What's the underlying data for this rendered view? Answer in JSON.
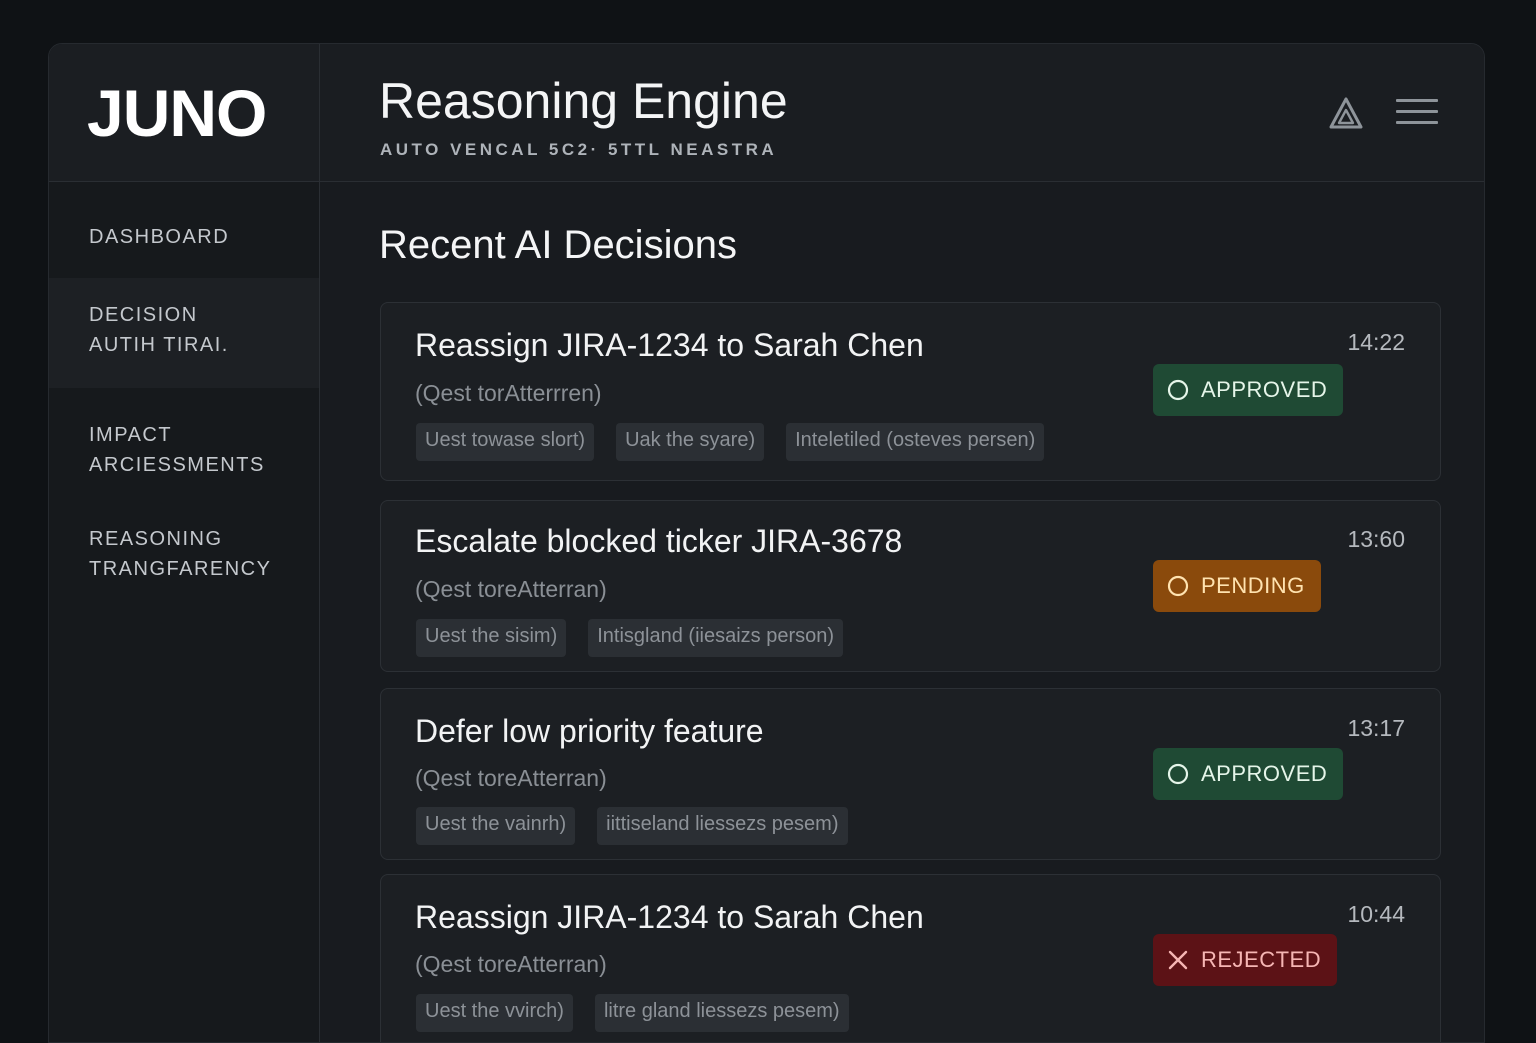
{
  "app": {
    "logo": "JUNO",
    "title": "Reasoning Engine",
    "subtitle": "AUTO VENCAL 5C2· 5TTL NEASTRA"
  },
  "header": {
    "icons": [
      "brand-triangle-icon",
      "hamburger-menu-icon"
    ]
  },
  "sidebar": {
    "items": [
      {
        "label": "DASHBOARD"
      },
      {
        "label": "DECISION\nAUTIH TIRAI."
      },
      {
        "label": "IMPACT\nARCIESSMENTS"
      },
      {
        "label": "REASONING\nTRANGFARENCY"
      }
    ]
  },
  "main": {
    "section_title": "Recent AI Decisions",
    "decisions": [
      {
        "title": "Reassign JIRA-1234 to Sarah  Chen",
        "subtitle": "(Qest torAtterrren)",
        "tags": [
          "Uest towase slort)",
          "Uak the syare)",
          "Inteletiled (osteves persen)"
        ],
        "time": "14:22",
        "status": "APPROVED",
        "status_icon": "circle-icon"
      },
      {
        "title": "Escalate blocked ticker JIRA-3678",
        "subtitle": "(Qest toreAtterran)",
        "tags": [
          "Uest the sisim)",
          "Intisgland (iiesaizs person)"
        ],
        "time": "13:60",
        "status": "PENDING",
        "status_icon": "circle-icon"
      },
      {
        "title": "Defer low  priority feature",
        "subtitle": "(Qest toreAtterran)",
        "tags": [
          "Uest the vainrh)",
          "iittiseland liessezs pesem)"
        ],
        "time": "13:17",
        "status": "APPROVED",
        "status_icon": "circle-icon"
      },
      {
        "title": "Reassign JIRA-1234 to Sarah  Chen",
        "subtitle": "(Qest toreAtterran)",
        "tags": [
          "Uest the vvirch)",
          "litre gland liessezs pesem)"
        ],
        "time": "10:44",
        "status": "REJECTED",
        "status_icon": "x-icon"
      }
    ]
  },
  "colors": {
    "approved": "#1f4a34",
    "pending": "#8a4a0c",
    "rejected": "#5c1216",
    "background": "#0f1215"
  }
}
